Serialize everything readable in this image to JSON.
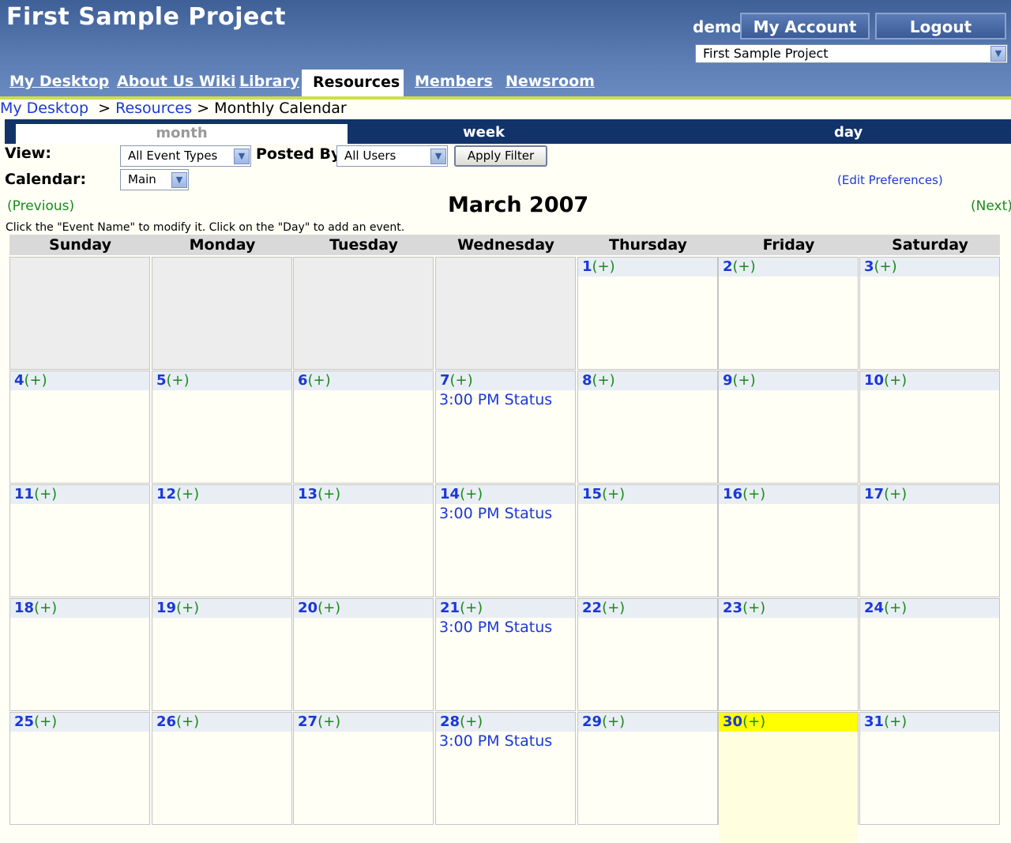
{
  "header": {
    "title": "First Sample Project",
    "username": "demo",
    "account_label": "My Account",
    "logout_label": "Logout",
    "project_select": "First Sample Project"
  },
  "nav_tabs": [
    "My Desktop",
    "About Us Wiki",
    "Library",
    "Resources",
    "Members",
    "Newsroom"
  ],
  "active_tab": "Resources",
  "breadcrumb": {
    "home": "My Desktop",
    "section": "Resources",
    "current": "Monthly Calendar",
    "sep": ">"
  },
  "view_tabs": {
    "month": "month",
    "week": "week",
    "day": "day"
  },
  "filters": {
    "view_label": "View:",
    "view_value": "All Event Types",
    "posted_by_label": "Posted By:",
    "posted_by_value": "All Users",
    "apply_label": "Apply Filter",
    "calendar_label": "Calendar:",
    "calendar_value": "Main",
    "edit_prefs": "(Edit Preferences)"
  },
  "calendar": {
    "month_title": "March 2007",
    "prev": "(Previous)",
    "next": "(Next)",
    "instructions": "Click the \"Event Name\" to modify it. Click on the \"Day\" to add an event.",
    "weekdays": [
      "Sunday",
      "Monday",
      "Tuesday",
      "Wednesday",
      "Thursday",
      "Friday",
      "Saturday"
    ],
    "add_label": "(+)",
    "first_weekday_index": 4,
    "days_in_month": 31,
    "today": 30,
    "events": {
      "7": "3:00 PM Status",
      "14": "3:00 PM Status",
      "21": "3:00 PM Status",
      "28": "3:00 PM Status"
    }
  }
}
